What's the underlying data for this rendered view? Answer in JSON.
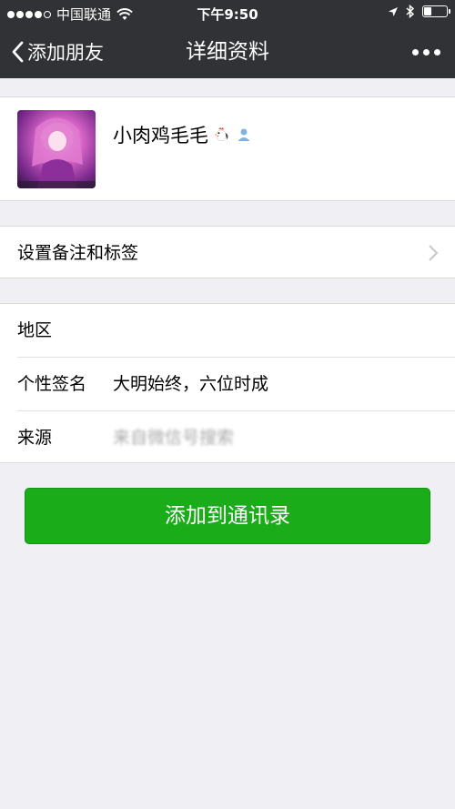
{
  "status_bar": {
    "carrier": "中国联通",
    "time": "下午9:50"
  },
  "nav": {
    "back_label": "添加朋友",
    "title": "详细资料"
  },
  "profile": {
    "nickname": "小肉鸡毛毛"
  },
  "remark": {
    "label": "设置备注和标签"
  },
  "info": {
    "region_label": "地区",
    "region_value": "",
    "signature_label": "个性签名",
    "signature_value": "大明始终，六位时成",
    "source_label": "来源",
    "source_value": "来自微信号搜索"
  },
  "actions": {
    "add_label": "添加到通讯录"
  },
  "colors": {
    "nav_bg": "#313236",
    "primary_button": "#1aad19",
    "page_bg": "#efeff4"
  }
}
